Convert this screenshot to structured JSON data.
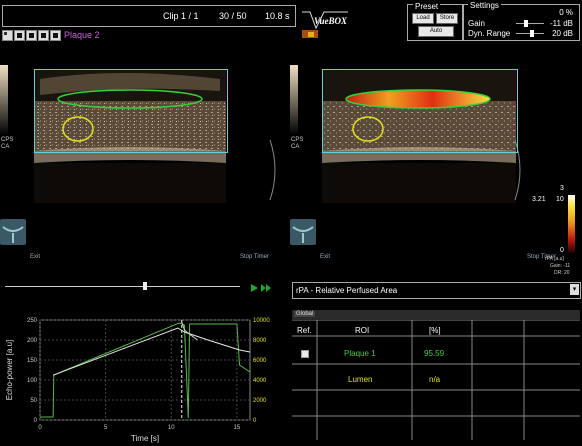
{
  "clip": {
    "label": "Clip 1 / 1",
    "frame": "30 / 50",
    "time": "10.8 s"
  },
  "roi_name": "Plaque 2",
  "logo_text": "VueBOX",
  "preset": {
    "title": "Preset",
    "load": "Load",
    "store": "Store",
    "auto": "Auto"
  },
  "settings": {
    "title": "Settings",
    "percent": "0 %",
    "gain_label": "Gain",
    "gain_value": "-11 dB",
    "dyn_label": "Dyn. Range",
    "dyn_value": "20 dB"
  },
  "left_image": {
    "mode1": "CPS",
    "mode2": "CA",
    "exit": "Exit",
    "stop": "Stop Timer"
  },
  "right_image": {
    "mode1": "CPS",
    "mode2": "CA",
    "exit": "Exit",
    "stop": "Stop Timer"
  },
  "colorbar": {
    "max": "3",
    "value": "3.21",
    "tick": "10",
    "min": "0",
    "unit": "rPA [a.u]",
    "gain": "Gain: -11",
    "dr": "DR: 20"
  },
  "param_select": "rPA - Relative Perfused Area",
  "colors": {
    "roi_outline": "#5fd0e0",
    "plaque1": "#3ad03a",
    "lumen": "#e0e020",
    "accent": "#22a822"
  },
  "table": {
    "tab": "Global",
    "headers": [
      "Ref.",
      "ROI",
      "[%]"
    ],
    "rows": [
      {
        "ref_checked": false,
        "roi": "Plaque 1",
        "value": "95.59"
      },
      {
        "ref_checked": null,
        "roi": "Lumen",
        "value": "n/a"
      }
    ]
  },
  "chart_data": {
    "type": "line",
    "xlabel": "Time [s]",
    "ylabel": "Echo-power [a.u]",
    "xlim": [
      0,
      16
    ],
    "ylim_left": [
      0,
      250
    ],
    "ylim_right": [
      0,
      10000
    ],
    "x_ticks": [
      "0",
      "5",
      "10",
      "15"
    ],
    "y_ticks_left": [
      "0",
      "50",
      "100",
      "150",
      "200",
      "250"
    ],
    "y_ticks_right": [
      "0",
      "2000",
      "4000",
      "6000",
      "8000",
      "10000"
    ],
    "cursor_x": 10.8,
    "series": [
      {
        "axis": "right",
        "color": "#5ab84a",
        "x": [
          0,
          1.0,
          1.05,
          10.6,
          11.0,
          11.3,
          11.4,
          15.0,
          15.2,
          16
        ],
        "y": [
          300,
          300,
          4500,
          9700,
          9500,
          200,
          9600,
          9600,
          5500,
          4800
        ]
      },
      {
        "axis": "left",
        "color": "#e8e8e8",
        "x": [
          1.0,
          10.5,
          11.0,
          12.8,
          15.2,
          16
        ],
        "y": [
          112,
          230,
          220,
          200,
          175,
          170
        ]
      },
      {
        "axis": "left",
        "color": "#d0d0d0",
        "x": [
          10.8,
          11.0,
          11.5,
          12.0
        ],
        "y": [
          245,
          225,
          212,
          200
        ]
      }
    ]
  }
}
